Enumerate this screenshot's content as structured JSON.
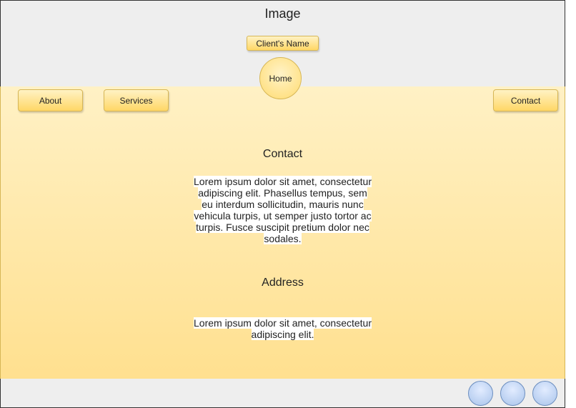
{
  "header": {
    "title": "Image",
    "client_name_label": "Client's Name",
    "home_label": "Home"
  },
  "nav": {
    "about_label": "About",
    "services_label": "Services",
    "contact_label": "Contact"
  },
  "contact_section": {
    "title": "Contact",
    "text": "Lorem ipsum dolor sit amet, consectetur adipiscing elit. Phasellus tempus, sem eu interdum sollicitudin, mauris nunc vehicula turpis, ut semper justo tortor ac turpis. Fusce suscipit pretium dolor nec sodales."
  },
  "address_section": {
    "title": "Address",
    "text": "Lorem ipsum dolor sit amet, consectetur adipiscing elit."
  },
  "footer": {
    "social_icons": [
      "social-circle-icon",
      "social-circle-icon",
      "social-circle-icon"
    ]
  },
  "colors": {
    "header_bg": "#eeeeee",
    "content_top": "#fff1c5",
    "content_bottom": "#ffe08f",
    "button_border": "#d6b656",
    "social_fill": "#a9c4eb",
    "social_border": "#6c8ebf"
  }
}
